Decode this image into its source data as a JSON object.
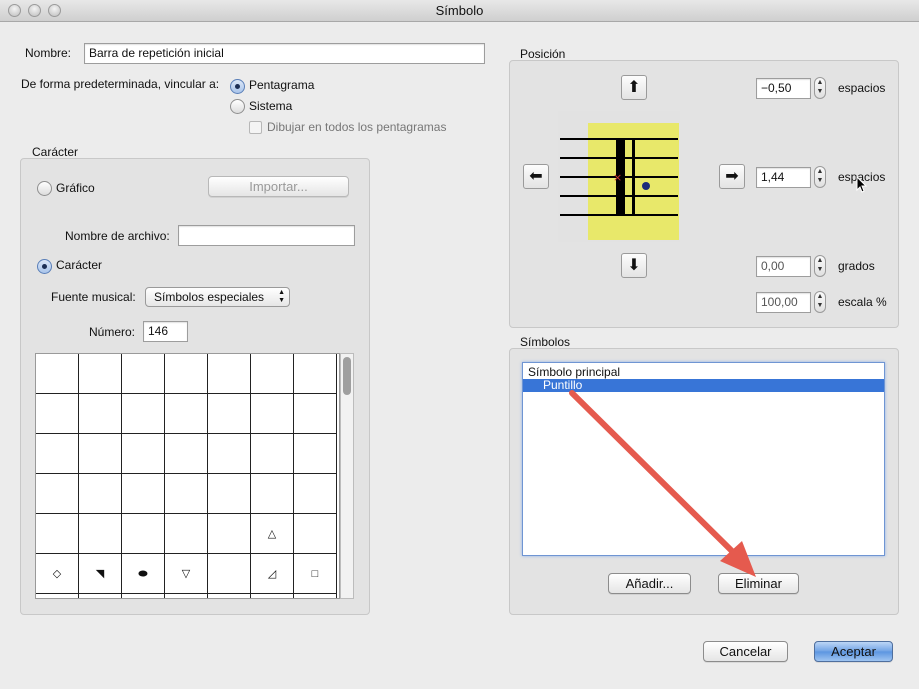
{
  "window": {
    "title": "Símbolo"
  },
  "nombre": {
    "label": "Nombre:",
    "value": "Barra de repetición inicial"
  },
  "vincular": {
    "label": "De forma predeterminada, vincular a:",
    "options": [
      "Pentagrama",
      "Sistema"
    ],
    "selected": "Pentagrama",
    "checkbox_label": "Dibujar en todos los pentagramas"
  },
  "caracter": {
    "group_title": "Carácter",
    "grafico_label": "Gráfico",
    "importar_label": "Importar...",
    "nombre_archivo_label": "Nombre de archivo:",
    "nombre_archivo_value": "",
    "caracter_label": "Carácter",
    "fuente_label": "Fuente musical:",
    "fuente_value": "Símbolos especiales",
    "numero_label": "Número:",
    "numero_value": "146",
    "grid_glyphs": [
      "",
      "",
      "",
      "",
      "",
      "",
      "",
      "",
      "",
      "",
      "",
      "",
      "",
      "",
      "",
      "",
      "",
      "",
      "",
      "",
      "",
      "",
      "",
      "",
      "",
      "",
      "",
      "",
      "",
      "",
      "",
      "",
      "",
      "△",
      "",
      "◇",
      "◥",
      "⬬",
      "▽",
      "",
      "◿",
      "□"
    ]
  },
  "posicion": {
    "group_title": "Posición",
    "x_value": "−0,50",
    "y_value": "1,44",
    "angle_value": "0,00",
    "scale_value": "100,00",
    "unit_spaces": "espacios",
    "unit_degrees": "grados",
    "unit_scale": "escala %"
  },
  "simbolos": {
    "group_title": "Símbolos",
    "items": [
      {
        "label": "Símbolo principal",
        "selected": false,
        "indent": false
      },
      {
        "label": "Puntillo",
        "selected": true,
        "indent": true
      }
    ],
    "add_label": "Añadir...",
    "delete_label": "Eliminar"
  },
  "footer": {
    "cancel_label": "Cancelar",
    "ok_label": "Aceptar"
  },
  "colors": {
    "accent": "#3875d7",
    "highlight": "#e8e86a",
    "annotation_arrow": "#e55a4e"
  }
}
